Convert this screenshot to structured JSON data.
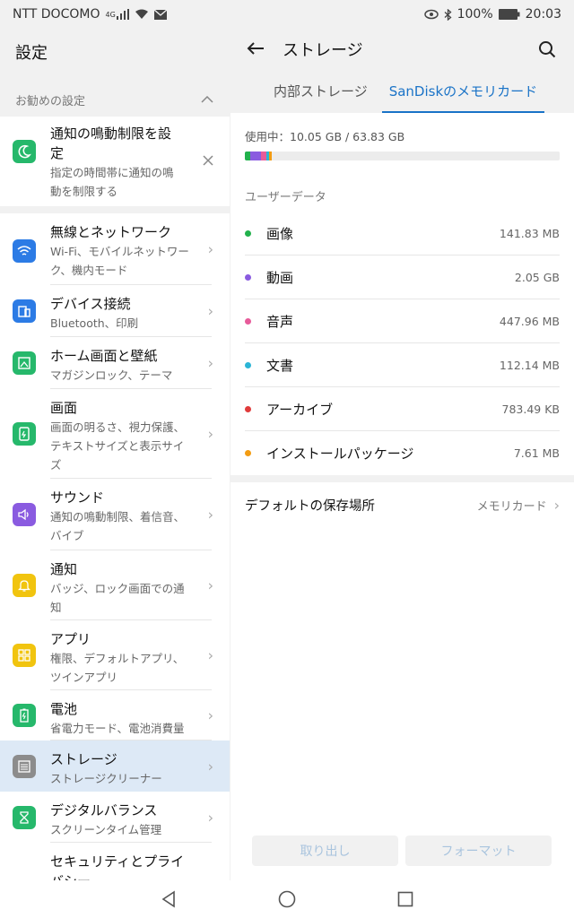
{
  "status_bar": {
    "carrier": "NTT DOCOMO",
    "network": "4G",
    "battery": "100%",
    "time": "20:03"
  },
  "left_pane": {
    "title": "設定",
    "recommended": {
      "header": "お勧めの設定",
      "card_title_line1": "通知の鳴動制限を設",
      "card_title_line2": "定",
      "card_sub_line1": "指定の時間帯に通知の鳴",
      "card_sub_line2": "動を制限する"
    },
    "items": [
      {
        "title": "無線とネットワーク",
        "sub1": "Wi-Fi、モバイルネットワー",
        "sub2": "ク、機内モード",
        "sub3": "",
        "color": "#2c7be5"
      },
      {
        "title": "デバイス接続",
        "sub1": "Bluetooth、印刷",
        "sub2": "",
        "sub3": "",
        "color": "#2c7be5"
      },
      {
        "title": "ホーム画面と壁紙",
        "sub1": "マガジンロック、テーマ",
        "sub2": "",
        "sub3": "",
        "color": "#26b86b"
      },
      {
        "title": "画面",
        "sub1": "画面の明るさ、視力保護、",
        "sub2": "テキストサイズと表示サイ",
        "sub3": "ズ",
        "color": "#26b86b"
      },
      {
        "title": "サウンド",
        "sub1": "通知の鳴動制限、着信音、",
        "sub2": "バイブ",
        "sub3": "",
        "color": "#8a5be0"
      },
      {
        "title": "通知",
        "sub1": "バッジ、ロック画面での通",
        "sub2": "知",
        "sub3": "",
        "color": "#f1c40f"
      },
      {
        "title": "アプリ",
        "sub1": "権限、デフォルトアプリ、",
        "sub2": "ツインアプリ",
        "sub3": "",
        "color": "#f1c40f"
      },
      {
        "title": "電池",
        "sub1": "省電力モード、電池消費量",
        "sub2": "",
        "sub3": "",
        "color": "#26b86b"
      },
      {
        "title": "ストレージ",
        "sub1": "ストレージクリーナー",
        "sub2": "",
        "sub3": "",
        "color": "#8c8c8c"
      },
      {
        "title": "デジタルバランス",
        "sub1": "スクリーンタイム管理",
        "sub2": "",
        "sub3": "",
        "color": "#26b86b"
      },
      {
        "title": "セキュリティとプライ",
        "sub1": "",
        "sub2": "",
        "sub3": "",
        "title2": "バシー",
        "color": "#26b86b"
      }
    ]
  },
  "right_pane": {
    "title": "ストレージ",
    "tabs": [
      "内部ストレージ",
      "SanDiskのメモリカード"
    ],
    "active_tab": 1,
    "usage_text": "使用中：10.05 GB / 63.83 GB",
    "user_data_label": "ユーザーデータ",
    "categories": [
      {
        "name": "画像",
        "size": "141.83 MB",
        "color": "#22b14c"
      },
      {
        "name": "動画",
        "size": "2.05 GB",
        "color": "#8a5be0"
      },
      {
        "name": "音声",
        "size": "447.96 MB",
        "color": "#e75b9a"
      },
      {
        "name": "文書",
        "size": "112.14 MB",
        "color": "#2bb5d6"
      },
      {
        "name": "アーカイブ",
        "size": "783.49 KB",
        "color": "#e03b3b"
      },
      {
        "name": "インストールパッケージ",
        "size": "7.61 MB",
        "color": "#f39c12"
      }
    ],
    "default_label": "デフォルトの保存場所",
    "default_value": "メモリカード",
    "eject_button": "取り出し",
    "format_button": "フォーマット"
  },
  "colors": {
    "accent": "#1a73c7",
    "active_row": "#dde9f6"
  }
}
